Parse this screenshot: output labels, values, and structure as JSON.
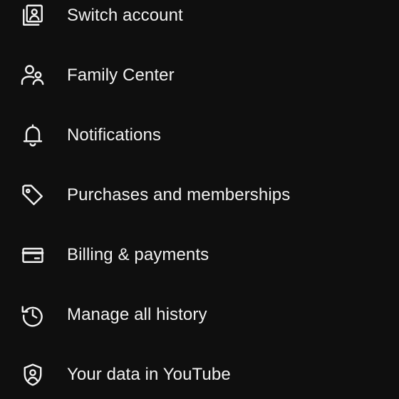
{
  "menu": {
    "items": [
      {
        "label": "Switch account",
        "icon": "switch-account-icon"
      },
      {
        "label": "Family Center",
        "icon": "family-center-icon"
      },
      {
        "label": "Notifications",
        "icon": "bell-icon"
      },
      {
        "label": "Purchases and memberships",
        "icon": "tag-icon"
      },
      {
        "label": "Billing & payments",
        "icon": "credit-card-icon"
      },
      {
        "label": "Manage all history",
        "icon": "history-icon"
      },
      {
        "label": "Your data in YouTube",
        "icon": "shield-person-icon"
      }
    ]
  },
  "colors": {
    "background": "#0f0f0f",
    "text": "#f1f1f1",
    "icon": "#f1f1f1"
  }
}
